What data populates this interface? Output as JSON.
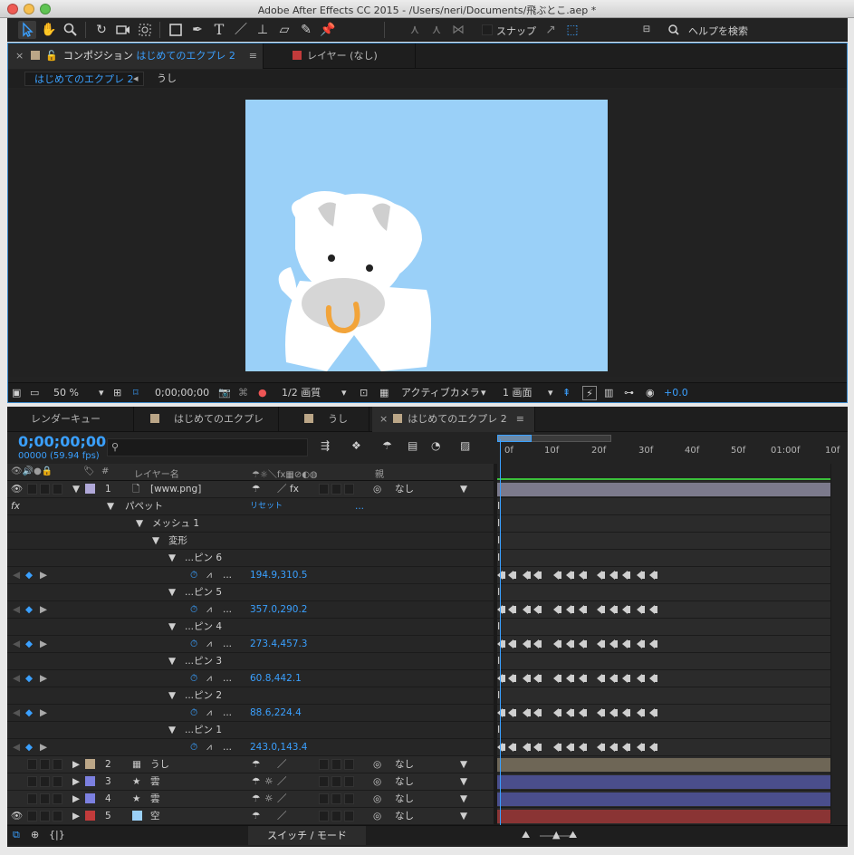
{
  "window": {
    "title": "Adobe After Effects CC 2015 - /Users/neri/Documents/飛ぶとこ.aep *",
    "traffic_lights": [
      "#ee5b53",
      "#f6bf4f",
      "#5fc453"
    ]
  },
  "toolbar": {
    "snap_label": "スナップ",
    "help_search": "ヘルプを検索",
    "tools": [
      "selection-tool",
      "hand-tool",
      "zoom-tool",
      "rotate-tool",
      "camera-tool",
      "pan-behind-tool",
      "rectangle-tool",
      "pen-tool",
      "type-tool",
      "brush-tool",
      "clone-stamp-tool",
      "eraser-tool",
      "roto-brush-tool",
      "puppet-pin-tool"
    ]
  },
  "composition_panel": {
    "tab_label": "コンポジション",
    "tab_comp_name": "はじめてのエクプレ 2",
    "layer_tab_label": "レイヤー (なし)",
    "breadcrumb_active": "はじめてのエクプレ 2",
    "breadcrumb_next": "うし",
    "viewer_bar": {
      "zoom": "50 %",
      "timecode": "0;00;00;00",
      "resolution": "1/2 画質",
      "camera": "アクティブカメラ",
      "views": "1 画面",
      "exposure": "+0.0"
    },
    "canvas_bg": "#9ad0f8"
  },
  "timeline": {
    "tabs": [
      "レンダーキュー",
      "はじめてのエクプレ",
      "うし",
      "はじめてのエクプレ 2"
    ],
    "timecode": "0;00;00;00",
    "frames_fps": "00000 (59.94 fps)",
    "columns": {
      "hash": "#",
      "layer_name": "レイヤー名",
      "parent": "親"
    },
    "ruler_ticks": [
      "0f",
      "10f",
      "20f",
      "30f",
      "40f",
      "50f",
      "01:00f",
      "10f"
    ],
    "rows": [
      {
        "type": "layer",
        "num": "1",
        "name": "[www.png]",
        "parent": "なし",
        "color": "#b0a8d8",
        "bar": "#7c7a8c"
      },
      {
        "type": "fx",
        "label": "パペット",
        "value": "リセット",
        "value2": "..."
      },
      {
        "type": "group",
        "indent": 1,
        "label": "メッシュ 1"
      },
      {
        "type": "group",
        "indent": 2,
        "label": "変形"
      },
      {
        "type": "group",
        "indent": 3,
        "label": "...ピン 6"
      },
      {
        "type": "prop",
        "value": "194.9,310.5"
      },
      {
        "type": "group",
        "indent": 3,
        "label": "...ピン 5"
      },
      {
        "type": "prop",
        "value": "357.0,290.2"
      },
      {
        "type": "group",
        "indent": 3,
        "label": "...ピン 4"
      },
      {
        "type": "prop",
        "value": "273.4,457.3"
      },
      {
        "type": "group",
        "indent": 3,
        "label": "...ピン 3"
      },
      {
        "type": "prop",
        "value": "60.8,442.1"
      },
      {
        "type": "group",
        "indent": 3,
        "label": "...ピン 2"
      },
      {
        "type": "prop",
        "value": "88.6,224.4"
      },
      {
        "type": "group",
        "indent": 3,
        "label": "...ピン 1"
      },
      {
        "type": "prop",
        "value": "243.0,143.4"
      },
      {
        "type": "layer",
        "num": "2",
        "name": "うし",
        "parent": "なし",
        "color": "#bba687",
        "bar": "#6e6656"
      },
      {
        "type": "layer",
        "num": "3",
        "name": "雲",
        "parent": "なし",
        "color": "#7c80e0",
        "bar": "#4a4e8c"
      },
      {
        "type": "layer",
        "num": "4",
        "name": "雲",
        "parent": "なし",
        "color": "#7c80e0",
        "bar": "#4a4e8c"
      },
      {
        "type": "layer",
        "num": "5",
        "name": "空",
        "parent": "なし",
        "color": "#c23b3b",
        "bar": "#8a3434"
      }
    ],
    "bottom_label": "スイッチ / モード"
  }
}
